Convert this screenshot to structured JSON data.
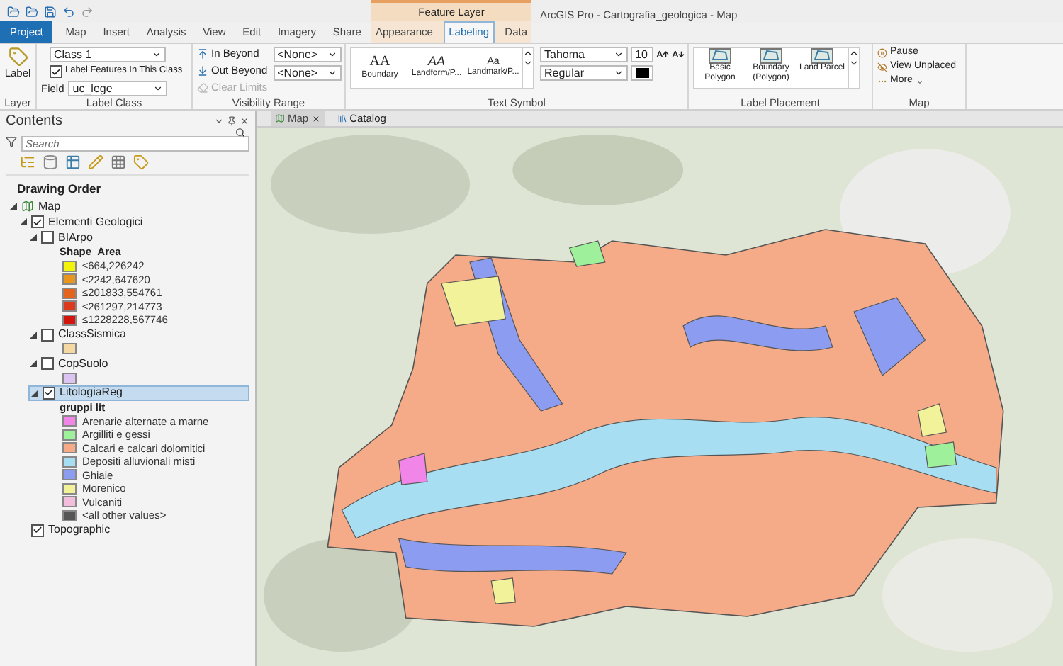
{
  "window": {
    "title": "ArcGIS Pro - Cartografia_geologica - Map"
  },
  "contextual_group": "Feature Layer",
  "tabs": [
    {
      "label": "Project",
      "kind": "backstage",
      "selected": false
    },
    {
      "label": "Map",
      "kind": "main",
      "selected": false
    },
    {
      "label": "Insert",
      "kind": "main",
      "selected": false
    },
    {
      "label": "Analysis",
      "kind": "main",
      "selected": false
    },
    {
      "label": "View",
      "kind": "main",
      "selected": false
    },
    {
      "label": "Edit",
      "kind": "main",
      "selected": false
    },
    {
      "label": "Imagery",
      "kind": "main",
      "selected": false
    },
    {
      "label": "Share",
      "kind": "main",
      "selected": false
    },
    {
      "label": "Appearance",
      "kind": "context",
      "selected": false
    },
    {
      "label": "Labeling",
      "kind": "context",
      "selected": true
    },
    {
      "label": "Data",
      "kind": "context",
      "selected": false
    }
  ],
  "ribbon": {
    "layer_group": {
      "title": "Layer",
      "button": "Label"
    },
    "label_class_group": {
      "title": "Label Class",
      "class_value": "Class 1",
      "label_features": {
        "label": "Label Features In This Class",
        "checked": true
      },
      "field_label": "Field",
      "field_value": "uc_lege"
    },
    "visibility_group": {
      "title": "Visibility Range",
      "buttons": [
        {
          "label": "In Beyond",
          "disabled": false
        },
        {
          "label": "Out Beyond",
          "disabled": false
        },
        {
          "label": "Clear Limits",
          "disabled": true
        }
      ],
      "dropdowns": [
        "<None>",
        "<None>"
      ]
    },
    "text_symbol_group": {
      "title": "Text Symbol",
      "styles": [
        {
          "sample": "AA",
          "kind": "serif",
          "name": "Boundary"
        },
        {
          "sample": "AA",
          "kind": "italic",
          "name": "Landform/P..."
        },
        {
          "sample": "Aa",
          "kind": "small",
          "name": "Landmark/P..."
        }
      ],
      "font": "Tahoma",
      "size": "10",
      "style": "Regular"
    },
    "placement_group": {
      "title": "Label Placement",
      "options": [
        {
          "label": "Basic Polygon",
          "selected": false
        },
        {
          "label": "Boundary (Polygon)",
          "selected": false
        },
        {
          "label": "Land Parcel",
          "selected": false
        }
      ]
    },
    "map_group": {
      "title": "Map",
      "buttons": [
        {
          "label": "Pause",
          "menu": false
        },
        {
          "label": "View Unplaced",
          "menu": false
        },
        {
          "label": "More",
          "menu": true
        }
      ]
    }
  },
  "contents": {
    "title": "Contents",
    "search_placeholder": "Search",
    "heading": "Drawing Order",
    "tree": [
      {
        "name": "Map",
        "kind": "map",
        "expanded": true,
        "children": [
          {
            "name": "Elementi Geologici",
            "kind": "layer",
            "checked": true,
            "expanded": true,
            "selected": false,
            "children": [
              {
                "name": "BIArpo",
                "kind": "layer",
                "checked": false,
                "expanded": true,
                "selected": false,
                "legend": {
                  "heading": "Shape_Area",
                  "classes": [
                    {
                      "label": "≤664,226242",
                      "color": "#f2f20a"
                    },
                    {
                      "label": "≤2242,647620",
                      "color": "#e8961e"
                    },
                    {
                      "label": "≤201833,554761",
                      "color": "#e4641e"
                    },
                    {
                      "label": "≤261297,214773",
                      "color": "#dc3a1e"
                    },
                    {
                      "label": "≤1228228,567746",
                      "color": "#d2140f"
                    }
                  ]
                }
              },
              {
                "name": "ClassSismica",
                "kind": "layer",
                "checked": false,
                "expanded": true,
                "selected": false,
                "legend": {
                  "classes": [
                    {
                      "color": "#f5d9a2"
                    }
                  ]
                }
              },
              {
                "name": "CopSuolo",
                "kind": "layer",
                "checked": false,
                "expanded": true,
                "selected": false,
                "legend": {
                  "classes": [
                    {
                      "color": "#dcc4f2"
                    }
                  ]
                }
              },
              {
                "name": "LitologiaReg",
                "kind": "layer",
                "checked": true,
                "expanded": true,
                "selected": true,
                "legend": {
                  "heading": "gruppi lit",
                  "classes": [
                    {
                      "label": "Arenarie alternate a marne",
                      "color": "#f285e8"
                    },
                    {
                      "label": "Argilliti e gessi",
                      "color": "#9ef09a"
                    },
                    {
                      "label": "Calcari e calcari dolomitici",
                      "color": "#f5aa88"
                    },
                    {
                      "label": "Depositi alluvionali misti",
                      "color": "#a8def2"
                    },
                    {
                      "label": "Ghiaie",
                      "color": "#8c9cf0"
                    },
                    {
                      "label": "Morenico",
                      "color": "#f2f29a"
                    },
                    {
                      "label": "Vulcaniti",
                      "color": "#f2bedc"
                    },
                    {
                      "label": "<all other values>",
                      "color": "#555555"
                    }
                  ]
                }
              }
            ]
          },
          {
            "name": "Topographic",
            "kind": "layer",
            "checked": true,
            "selected": false
          }
        ]
      }
    ]
  },
  "map_tabs": [
    {
      "label": "Map",
      "selected": true,
      "closable": true
    },
    {
      "label": "Catalog",
      "selected": false,
      "closable": false
    }
  ]
}
